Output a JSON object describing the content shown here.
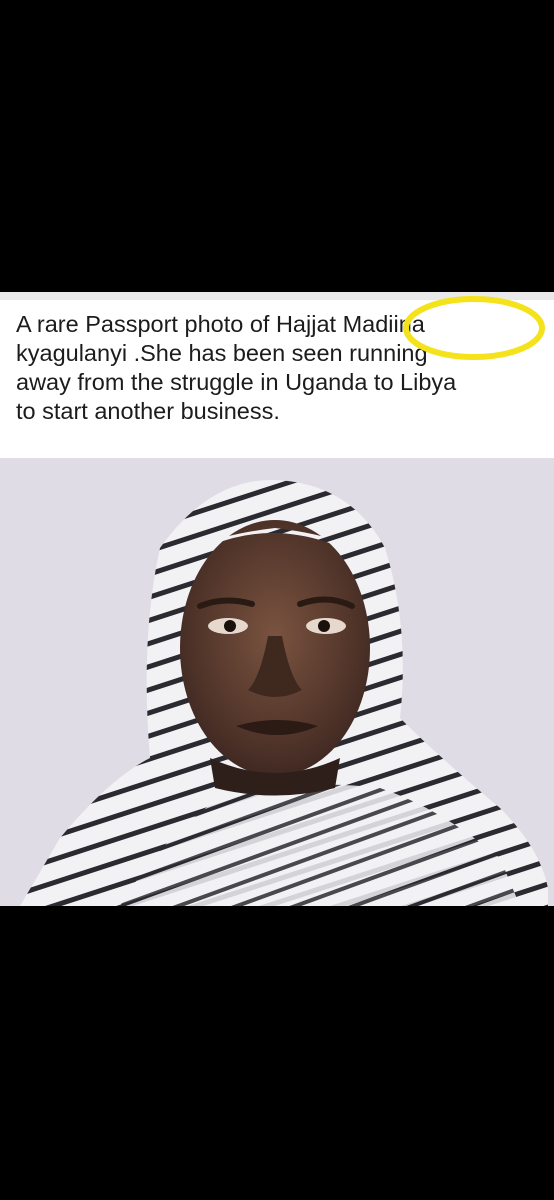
{
  "caption": {
    "line1": "A rare Passport photo of Hajjat  Madiina",
    "line2": "kyagulanyi .She has been seen running",
    "line3": "away from the struggle in Uganda to Libya",
    "line4": "to start another business."
  },
  "highlight_color": "#f4e21a",
  "photo": {
    "subject": "person-wearing-striped-headscarf",
    "background_color": "#ddd8e3",
    "scarf_stripe_color": "#2b2a30"
  }
}
